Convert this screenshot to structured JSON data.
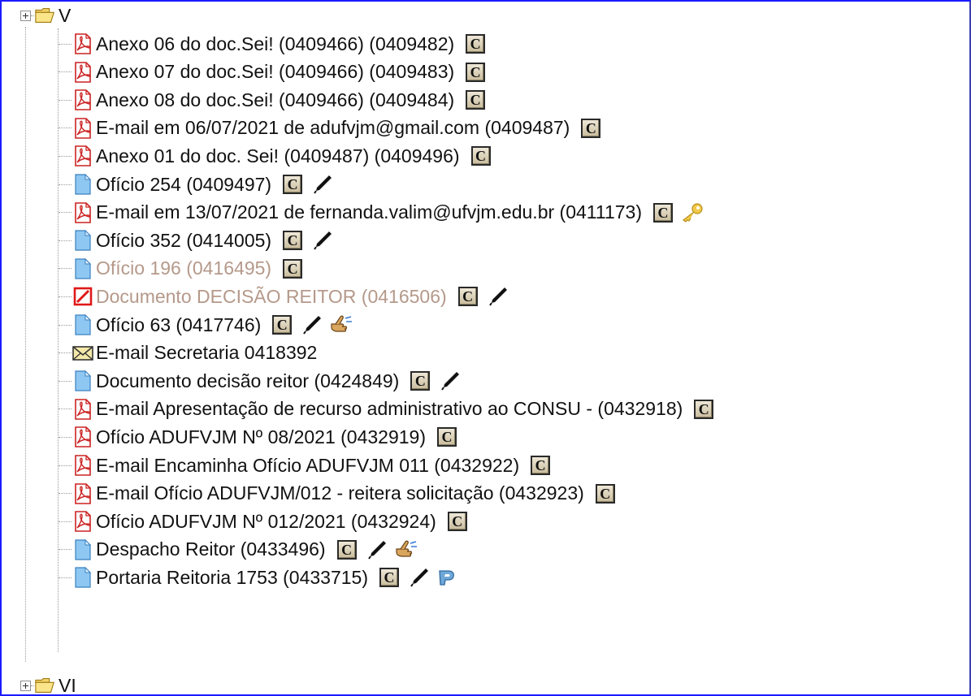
{
  "tree": {
    "folders": [
      {
        "label": "V",
        "icon": "folder-open-icon"
      },
      {
        "label": "VI",
        "icon": "folder-open-icon"
      }
    ],
    "items": [
      {
        "type": "pdf",
        "label": "Anexo 06 do doc.Sei! (0409466) (0409482)",
        "c": "C"
      },
      {
        "type": "pdf",
        "label": "Anexo 07 do doc.Sei! (0409466) (0409483)",
        "c": "C"
      },
      {
        "type": "pdf",
        "label": "Anexo 08 do doc.Sei! (0409466) (0409484)",
        "c": "C"
      },
      {
        "type": "pdf",
        "label": "E-mail em 06/07/2021 de adufvjm@gmail.com (0409487)",
        "c": "C"
      },
      {
        "type": "pdf",
        "label": "Anexo 01 do doc. Sei! (0409487) (0409496)",
        "c": "C"
      },
      {
        "type": "doc",
        "label": "Ofício 254 (0409497)",
        "c": "C",
        "pen": true
      },
      {
        "type": "pdf",
        "label": "E-mail em 13/07/2021 de fernanda.valim@ufvjm.edu.br (0411173)",
        "c": "C",
        "key": true
      },
      {
        "type": "doc",
        "label": "Ofício 352 (0414005)",
        "c": "C",
        "pen": true
      },
      {
        "type": "doc",
        "label": "Ofício 196 (0416495)",
        "c": "C",
        "dim": true
      },
      {
        "type": "cancel",
        "label": "Documento DECISÃO REITOR (0416506)",
        "c": "C",
        "pen": true,
        "dim": true
      },
      {
        "type": "doc",
        "label": "Ofício 63 (0417746)",
        "c": "C",
        "pen": true,
        "hand": true
      },
      {
        "type": "mail",
        "label": "E-mail Secretaria 0418392"
      },
      {
        "type": "doc",
        "label": "Documento decisão reitor (0424849)",
        "c": "C",
        "pen": true
      },
      {
        "type": "pdf",
        "label": "E-mail Apresentação de recurso administrativo ao CONSU - (0432918)",
        "c": "C"
      },
      {
        "type": "pdf",
        "label": "Ofício ADUFVJM Nº 08/2021 (0432919)",
        "c": "C"
      },
      {
        "type": "pdf",
        "label": "E-mail Encaminha Ofício ADUFVJM 011 (0432922)",
        "c": "C"
      },
      {
        "type": "pdf",
        "label": "E-mail Ofício ADUFVJM/012 - reitera solicitação (0432923)",
        "c": "C"
      },
      {
        "type": "pdf",
        "label": "Ofício ADUFVJM Nº 012/2021 (0432924)",
        "c": "C"
      },
      {
        "type": "doc",
        "label": "Despacho Reitor (0433496)",
        "c": "C",
        "pen": true,
        "hand": true
      },
      {
        "type": "doc",
        "label": "Portaria Reitoria 1753 (0433715)",
        "c": "C",
        "pen": true,
        "publish": true
      }
    ]
  },
  "colors": {
    "dim_text": "#b5998a",
    "border": "#1a1aff",
    "pdf_red": "#d62020",
    "doc_blue": "#7fbfef"
  }
}
